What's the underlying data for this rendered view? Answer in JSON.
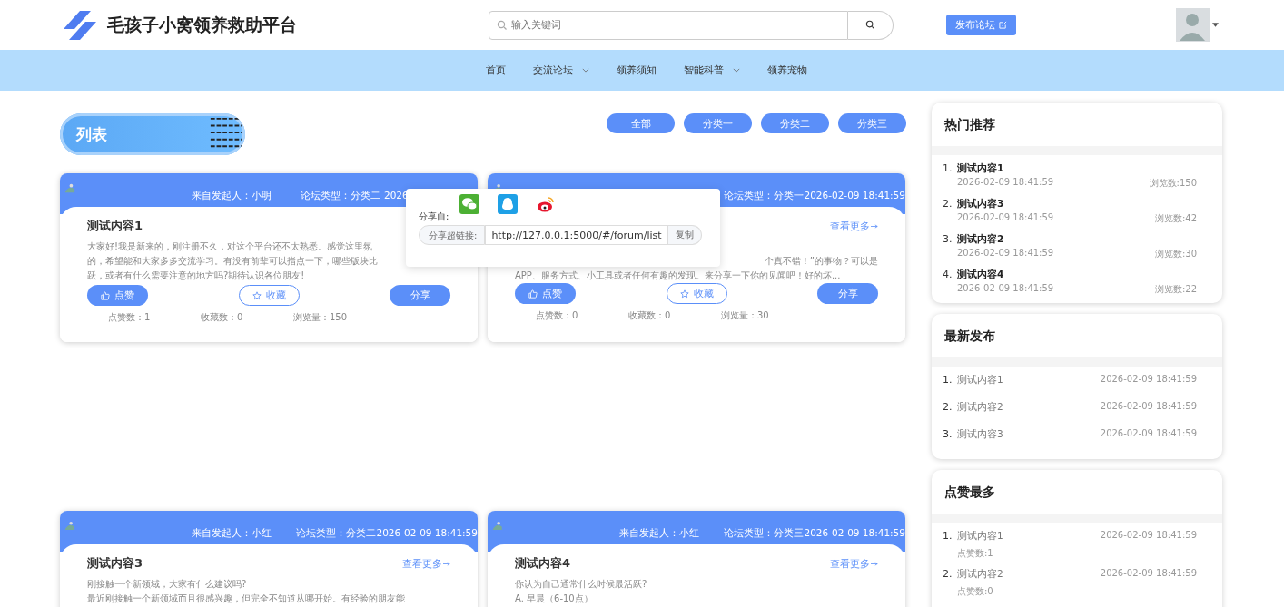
{
  "header": {
    "site_title": "毛孩子小窝领养救助平台",
    "search": {
      "placeholder": "输入关键词"
    },
    "publish_button": "发布论坛"
  },
  "nav": [
    {
      "label": "首页",
      "has_menu": false
    },
    {
      "label": "交流论坛",
      "has_menu": true
    },
    {
      "label": "领养须知",
      "has_menu": false
    },
    {
      "label": "智能科普",
      "has_menu": true
    },
    {
      "label": "领养宠物",
      "has_menu": false
    }
  ],
  "list_title": "列表",
  "filters": [
    "全部",
    "分类一",
    "分类二",
    "分类三"
  ],
  "posts": [
    {
      "author": "来自发起人：小明",
      "type": "论坛类型：分类二",
      "time": "2026",
      "title": "测试内容1",
      "share_open": true,
      "content": [
        "大家好!我是新来的，刚注册不久，对这个平台还不太熟悉。感觉这里氛",
        "的，希望能和大家多多交流学习。有没有前辈可以指点一下，哪些版块比",
        "跃，或者有什么需要注意的地方吗?期待认识各位朋友!"
      ],
      "actions": [
        {
          "kind": "like",
          "label": "点赞"
        },
        {
          "kind": "collect",
          "label": "收藏"
        },
        {
          "kind": "share",
          "label": "分享"
        }
      ],
      "stats": [
        "点赞数：1",
        "收藏数：0",
        "浏览量：150"
      ]
    },
    {
      "type": "论坛类型：分类一",
      "time": "2026-02-09 18:41:59",
      "more": "查看更多",
      "share_open": false,
      "content": [
        "个真不错！”的事物？可以是",
        "APP、服务方式、小工具或者任何有趣的发现。来分享一下你的见闻吧！好的坏..."
      ],
      "actions": [
        {
          "kind": "like",
          "label": "点赞"
        },
        {
          "kind": "collect",
          "label": "收藏"
        },
        {
          "kind": "share",
          "label": "分享"
        }
      ],
      "stats": [
        "点赞数：0",
        "收藏数：0",
        "浏览量：30"
      ]
    },
    {
      "author": "来自发起人：小红",
      "type": "论坛类型：分类二",
      "time": "2026-02-09 18:41:59",
      "title": "测试内容3",
      "more": "查看更多",
      "share_open": false,
      "content": [
        "刚接触一个新领域，大家有什么建议吗?",
        "最近刚接触一个新领域而且很感兴趣，但完全不知道从哪开始。有经验的朋友能"
      ]
    },
    {
      "author": "来自发起人：小红",
      "type": "论坛类型：分类三",
      "time": "2026-02-09 18:41:59",
      "title": "测试内容4",
      "more": "查看更多",
      "share_open": false,
      "content": [
        "你认为自己通常什么时候最活跃?",
        "A. 早晨（6-10点）"
      ]
    }
  ],
  "share_popup": {
    "label": "分享自:",
    "link_label": "分享超链接:",
    "url": "http://127.0.0.1:5000/#/forum/list",
    "copy_button": "复制"
  },
  "sidebar": [
    {
      "title": "热门推荐",
      "kind": "views",
      "items": [
        {
          "rank": "1.",
          "title": "测试内容1",
          "time": "2026-02-09 18:41:59",
          "extra": "浏览数:150"
        },
        {
          "rank": "2.",
          "title": "测试内容3",
          "time": "2026-02-09 18:41:59",
          "extra": "浏览数:42"
        },
        {
          "rank": "3.",
          "title": "测试内容2",
          "time": "2026-02-09 18:41:59",
          "extra": "浏览数:30"
        },
        {
          "rank": "4.",
          "title": "测试内容4",
          "time": "2026-02-09 18:41:59",
          "extra": "浏览数:22"
        }
      ]
    },
    {
      "title": "最新发布",
      "kind": "latest",
      "items": [
        {
          "rank": "1.",
          "title": "测试内容1",
          "time": "2026-02-09 18:41:59"
        },
        {
          "rank": "2.",
          "title": "测试内容2",
          "time": "2026-02-09 18:41:59"
        },
        {
          "rank": "3.",
          "title": "测试内容3",
          "time": "2026-02-09 18:41:59"
        }
      ]
    },
    {
      "title": "点赞最多",
      "kind": "likes",
      "items": [
        {
          "rank": "1.",
          "title": "测试内容1",
          "time": "2026-02-09 18:41:59",
          "extra": "点赞数:1"
        },
        {
          "rank": "2.",
          "title": "测试内容2",
          "time": "2026-02-09 18:41:59",
          "extra": "点赞数:0"
        }
      ]
    }
  ]
}
